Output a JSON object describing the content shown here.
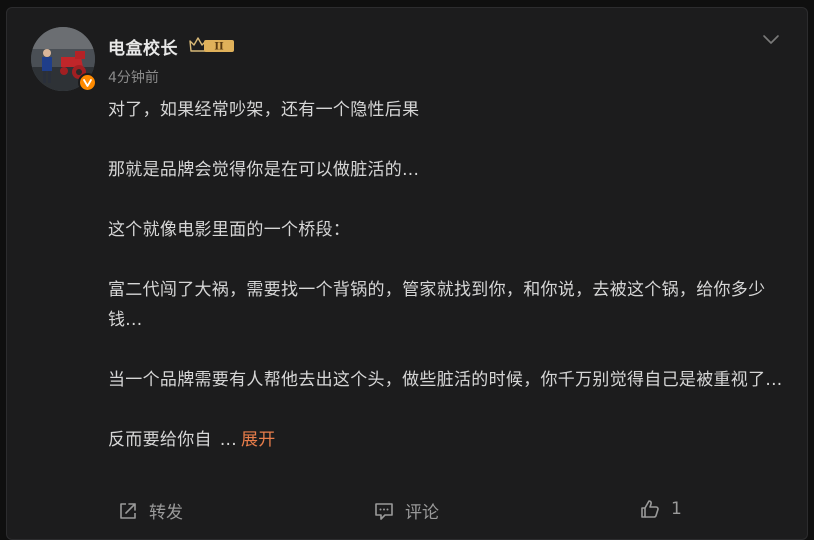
{
  "post": {
    "author": "电盒校长",
    "level_badge": "II",
    "time": "4分钟前",
    "paragraphs": [
      "对了，如果经常吵架，还有一个隐性后果",
      "那就是品牌会觉得你是在可以做脏活的...",
      "这个就像电影里面的一个桥段：",
      "富二代闯了大祸，需要找一个背锅的，管家就找到你，和你说，去被这个锅，给你多少钱...",
      "当一个品牌需要有人帮他去出这个头，做些脏活的时候，你千万别觉得自己是被重视了..."
    ],
    "truncated_text": "反而要给你自",
    "ellipsis": "...",
    "expand_label": "展开"
  },
  "actions": {
    "repost_label": "转发",
    "comment_label": "评论",
    "like_count": "1"
  },
  "colors": {
    "background": "#1c1c1d",
    "text": "#d6d6d6",
    "expand_link": "#e87d4a",
    "verified": "#ff8a00"
  },
  "icons": [
    "chevron-down-icon",
    "crown-badge-icon",
    "verified-icon",
    "repost-icon",
    "comment-icon",
    "like-icon"
  ]
}
